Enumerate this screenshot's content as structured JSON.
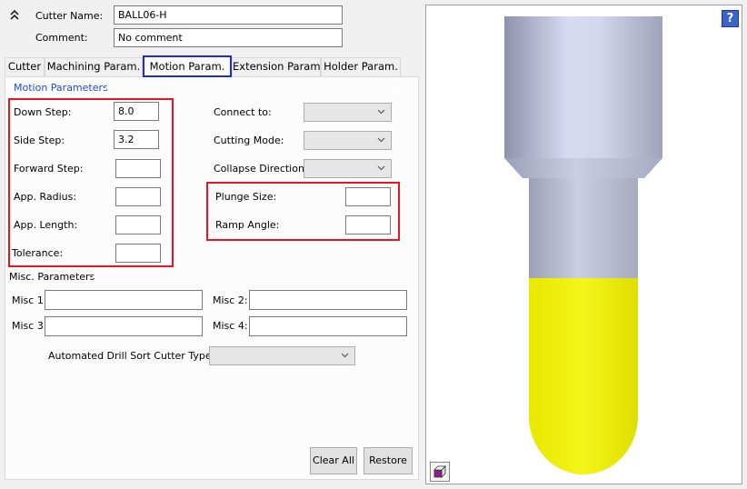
{
  "header": {
    "cutter_name_label": "Cutter Name:",
    "cutter_name_value": "BALL06-H",
    "comment_label": "Comment:",
    "comment_value": "No comment"
  },
  "tabs": [
    {
      "label": "Cutter"
    },
    {
      "label": "Machining Param."
    },
    {
      "label": "Motion Param."
    },
    {
      "label": "Extension Param."
    },
    {
      "label": "Holder Param."
    }
  ],
  "active_tab": "Motion Param.",
  "motion": {
    "group_title": "Motion Parameters",
    "down_step_label": "Down Step:",
    "down_step_value": "8.0",
    "side_step_label": "Side Step:",
    "side_step_value": "3.2",
    "forward_step_label": "Forward Step:",
    "forward_step_value": "",
    "app_radius_label": "App. Radius:",
    "app_radius_value": "",
    "app_length_label": "App. Length:",
    "app_length_value": "",
    "tolerance_label": "Tolerance:",
    "tolerance_value": "",
    "connect_to_label": "Connect to:",
    "cutting_mode_label": "Cutting Mode:",
    "collapse_direction_label": "Collapse Direction:",
    "plunge_size_label": "Plunge Size:",
    "plunge_size_value": "",
    "ramp_angle_label": "Ramp Angle:",
    "ramp_angle_value": ""
  },
  "misc": {
    "group_title": "Misc. Parameters",
    "misc1_label": "Misc 1:",
    "misc2_label": "Misc 2:",
    "misc3_label": "Misc 3:",
    "misc4_label": "Misc 4:",
    "drill_sort_label": "Automated Drill Sort Cutter Type :"
  },
  "buttons": {
    "clear_all": "Clear All",
    "restore": "Restore"
  },
  "colors": {
    "highlight_red": "#e8141f",
    "active_tab_blue": "#1f2bd8",
    "holder_grey": "#b4b8cc",
    "ball_yellow": "#f2f20a"
  }
}
